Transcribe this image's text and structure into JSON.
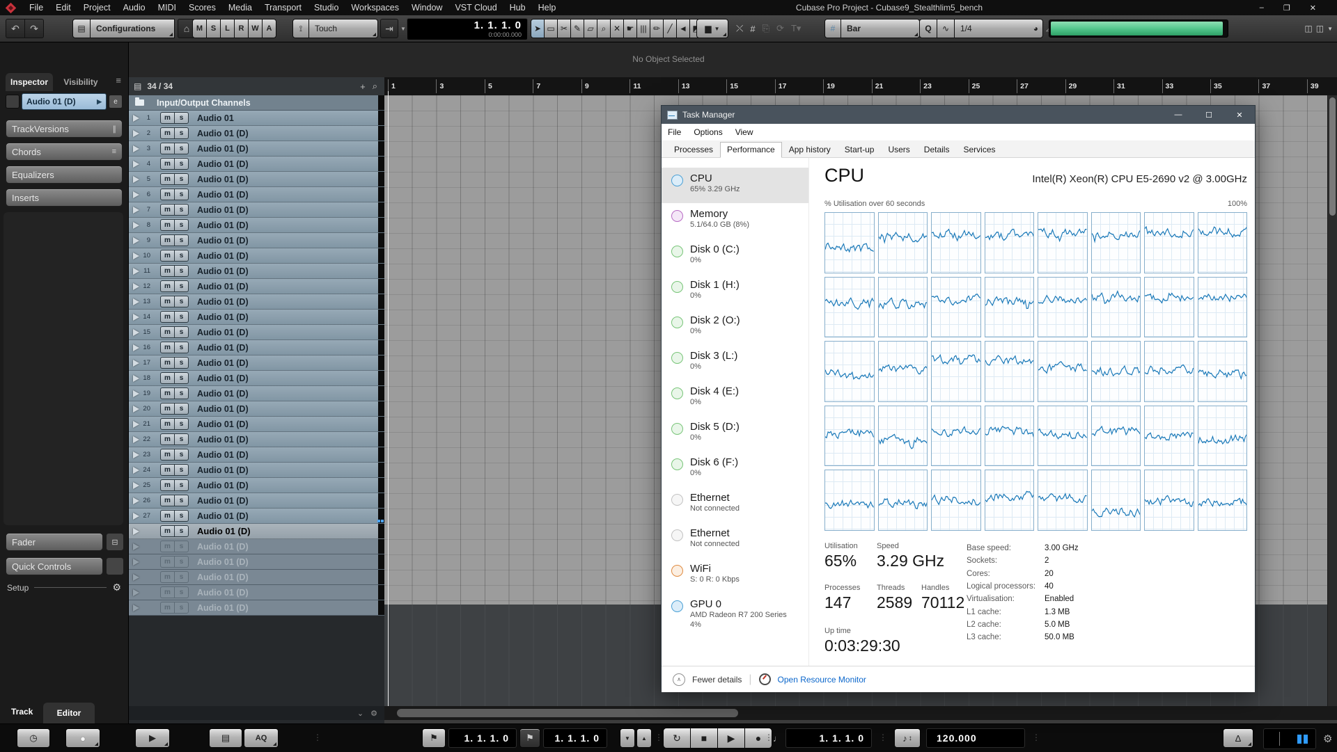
{
  "colors": {
    "meter_green": "#54c78d",
    "tm_titlebar": "#49535d",
    "tm_graph_line": "#1878b8",
    "tm_link": "#0a66cb"
  },
  "menubar": {
    "items": [
      "File",
      "Edit",
      "Project",
      "Audio",
      "MIDI",
      "Scores",
      "Media",
      "Transport",
      "Studio",
      "Workspaces",
      "Window",
      "VST Cloud",
      "Hub",
      "Help"
    ],
    "title": "Cubase Pro Project - Cubase9_Stealthlim5_bench",
    "window_controls": [
      "–",
      "❐",
      "✕"
    ]
  },
  "toolbar": {
    "undo": "↶",
    "redo": "↷",
    "configurations_label": "Configurations",
    "automation_buttons": [
      "M",
      "S",
      "L",
      "R",
      "W",
      "A"
    ],
    "automation_mode": "Touch",
    "time_display_primary": "1.  1.  1.   0",
    "time_display_secondary": "0:00:00.000",
    "tools": [
      "➤",
      "▭",
      "✂",
      "✎",
      "▱",
      "⌕",
      "✕",
      "☛",
      "|||",
      "✏",
      "╱",
      "◄",
      "◩"
    ],
    "grid_type": "Bar",
    "quantize_label": "Q",
    "wave_label": "∿",
    "quantize_value": "1/4"
  },
  "info_line": {
    "status": "No Object Selected"
  },
  "inspector": {
    "tabs": [
      {
        "label": "Inspector",
        "active": true
      },
      {
        "label": "Visibility",
        "active": false
      }
    ],
    "track_header": "Audio 01 (D)",
    "sections": [
      {
        "label": "TrackVersions",
        "icon": "∥"
      },
      {
        "label": "Chords",
        "icon": "≡"
      },
      {
        "label": "Equalizers",
        "icon": ""
      },
      {
        "label": "Inserts",
        "icon": ""
      }
    ],
    "lower_sections": [
      "Fader",
      "Quick Controls"
    ],
    "setup_label": "Setup",
    "bottom_tabs": [
      "Track",
      "Editor"
    ]
  },
  "track_list": {
    "counter": "34 / 34",
    "folder_row": "Input/Output Channels",
    "mute_label": "m",
    "solo_label": "s",
    "tracks": [
      {
        "num": "1",
        "name": "Audio 01"
      },
      {
        "num": "2",
        "name": "Audio 01 (D)"
      },
      {
        "num": "3",
        "name": "Audio 01 (D)"
      },
      {
        "num": "4",
        "name": "Audio 01 (D)"
      },
      {
        "num": "5",
        "name": "Audio 01 (D)"
      },
      {
        "num": "6",
        "name": "Audio 01 (D)"
      },
      {
        "num": "7",
        "name": "Audio 01 (D)"
      },
      {
        "num": "8",
        "name": "Audio 01 (D)"
      },
      {
        "num": "9",
        "name": "Audio 01 (D)"
      },
      {
        "num": "10",
        "name": "Audio 01 (D)"
      },
      {
        "num": "11",
        "name": "Audio 01 (D)"
      },
      {
        "num": "12",
        "name": "Audio 01 (D)"
      },
      {
        "num": "13",
        "name": "Audio 01 (D)"
      },
      {
        "num": "14",
        "name": "Audio 01 (D)"
      },
      {
        "num": "15",
        "name": "Audio 01 (D)"
      },
      {
        "num": "16",
        "name": "Audio 01 (D)"
      },
      {
        "num": "17",
        "name": "Audio 01 (D)"
      },
      {
        "num": "18",
        "name": "Audio 01 (D)"
      },
      {
        "num": "19",
        "name": "Audio 01 (D)"
      },
      {
        "num": "20",
        "name": "Audio 01 (D)"
      },
      {
        "num": "21",
        "name": "Audio 01 (D)"
      },
      {
        "num": "22",
        "name": "Audio 01 (D)"
      },
      {
        "num": "23",
        "name": "Audio 01 (D)"
      },
      {
        "num": "24",
        "name": "Audio 01 (D)"
      },
      {
        "num": "25",
        "name": "Audio 01 (D)"
      },
      {
        "num": "26",
        "name": "Audio 01 (D)"
      },
      {
        "num": "27",
        "name": "Audio 01 (D)"
      }
    ],
    "selected_row": "Audio 01 (D)",
    "dim_rows": [
      "Audio 01 (D)",
      "Audio 01 (D)",
      "Audio 01 (D)",
      "Audio 01 (D)",
      "Audio 01 (D)"
    ]
  },
  "ruler": {
    "numbers": [
      "1",
      "3",
      "5",
      "7",
      "9",
      "11",
      "13",
      "15",
      "17",
      "19",
      "21",
      "23",
      "25",
      "27",
      "29",
      "31",
      "33",
      "35",
      "37",
      "39"
    ]
  },
  "task_manager": {
    "title": "Task Manager",
    "menu": [
      "File",
      "Options",
      "View"
    ],
    "tabs": [
      {
        "label": "Processes",
        "active": false
      },
      {
        "label": "Performance",
        "active": true
      },
      {
        "label": "App history",
        "active": false
      },
      {
        "label": "Start-up",
        "active": false
      },
      {
        "label": "Users",
        "active": false
      },
      {
        "label": "Details",
        "active": false
      },
      {
        "label": "Services",
        "active": false
      }
    ],
    "sidebar": [
      {
        "name": "CPU",
        "sub": "65% 3.29 GHz",
        "color": "blue",
        "selected": true
      },
      {
        "name": "Memory",
        "sub": "5.1/64.0 GB (8%)",
        "color": "purple",
        "selected": false
      },
      {
        "name": "Disk 0 (C:)",
        "sub": "0%",
        "color": "green",
        "selected": false
      },
      {
        "name": "Disk 1 (H:)",
        "sub": "0%",
        "color": "green",
        "selected": false
      },
      {
        "name": "Disk 2 (O:)",
        "sub": "0%",
        "color": "green",
        "selected": false
      },
      {
        "name": "Disk 3 (L:)",
        "sub": "0%",
        "color": "green",
        "selected": false
      },
      {
        "name": "Disk 4 (E:)",
        "sub": "0%",
        "color": "green",
        "selected": false
      },
      {
        "name": "Disk 5 (D:)",
        "sub": "0%",
        "color": "green",
        "selected": false
      },
      {
        "name": "Disk 6 (F:)",
        "sub": "0%",
        "color": "green",
        "selected": false
      },
      {
        "name": "Ethernet",
        "sub": "Not connected",
        "color": "gray",
        "selected": false
      },
      {
        "name": "Ethernet",
        "sub": "Not connected",
        "color": "gray",
        "selected": false
      },
      {
        "name": "WiFi",
        "sub": "S: 0 R: 0 Kbps",
        "color": "orange",
        "selected": false
      },
      {
        "name": "GPU 0",
        "sub": "AMD Radeon R7 200 Series",
        "sub2": "4%",
        "color": "blue",
        "selected": false
      }
    ],
    "cpu_panel": {
      "title": "CPU",
      "chip": "Intel(R) Xeon(R) CPU E5-2690 v2 @ 3.00GHz",
      "graph_caption": "% Utilisation over 60 seconds",
      "graph_scale": "100%",
      "big_stats": [
        {
          "label": "Utilisation",
          "value": "65%"
        },
        {
          "label": "Speed",
          "value": "3.29 GHz"
        },
        {
          "label": "Processes",
          "value": "147"
        },
        {
          "label": "Threads",
          "value": "2589"
        },
        {
          "label": "Handles",
          "value": "70112"
        },
        {
          "label": "Up time",
          "value": "0:03:29:30"
        }
      ],
      "detail_stats": [
        {
          "label": "Base speed:",
          "value": "3.00 GHz"
        },
        {
          "label": "Sockets:",
          "value": "2"
        },
        {
          "label": "Cores:",
          "value": "20"
        },
        {
          "label": "Logical processors:",
          "value": "40"
        },
        {
          "label": "Virtualisation:",
          "value": "Enabled"
        },
        {
          "label": "L1 cache:",
          "value": "1.3 MB"
        },
        {
          "label": "L2 cache:",
          "value": "5.0 MB"
        },
        {
          "label": "L3 cache:",
          "value": "50.0 MB"
        }
      ],
      "graph_levels": [
        0.62,
        0.38,
        0.33,
        0.36,
        0.32,
        0.35,
        0.3,
        0.27,
        0.42,
        0.44,
        0.36,
        0.4,
        0.36,
        0.32,
        0.31,
        0.3,
        0.55,
        0.45,
        0.27,
        0.31,
        0.44,
        0.5,
        0.46,
        0.54,
        0.46,
        0.58,
        0.42,
        0.4,
        0.46,
        0.42,
        0.5,
        0.56,
        0.58,
        0.54,
        0.5,
        0.42,
        0.46,
        0.72,
        0.52,
        0.55
      ]
    },
    "footer": {
      "fewer_details": "Fewer details",
      "resource_monitor": "Open Resource Monitor"
    }
  },
  "transport": {
    "aq_label": "AQ",
    "left_locator": "1.  1.  1.   0",
    "right_locator": "1.  1.  1.   0",
    "time_display": "1.  1.  1.   0",
    "tempo": "120.000"
  }
}
